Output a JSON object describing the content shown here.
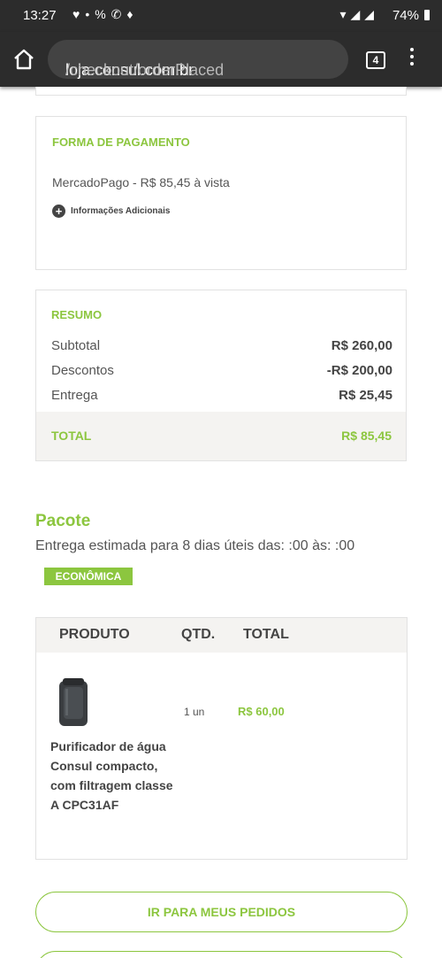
{
  "status_bar": {
    "time": "13:27",
    "battery": "74%"
  },
  "browser": {
    "url_domain": "loja.consul.com.br",
    "url_path": "/checkout/orderPlaced",
    "tab_count": "4"
  },
  "payment": {
    "title": "FORMA DE PAGAMENTO",
    "method": "MercadoPago - R$ 85,45 à vista",
    "info_link": "Informações Adicionais"
  },
  "summary": {
    "title": "RESUMO",
    "rows": [
      {
        "label": "Subtotal",
        "value": "R$ 260,00"
      },
      {
        "label": "Descontos",
        "value": "-R$ 200,00"
      },
      {
        "label": "Entrega",
        "value": "R$ 25,45"
      }
    ],
    "total_label": "TOTAL",
    "total_value": "R$ 85,45"
  },
  "package": {
    "title": "Pacote",
    "delivery": "Entrega estimada para 8 dias úteis das: :00 às: :00",
    "badge": "ECONÔMICA"
  },
  "products": {
    "headers": {
      "product": "PRODUTO",
      "qty": "QTD.",
      "total": "TOTAL"
    },
    "items": [
      {
        "name": "Purificador de água Consul compacto, com filtragem classe A CPC31AF",
        "qty": "1 un",
        "total": "R$ 60,00"
      }
    ]
  },
  "buttons": {
    "my_orders": "IR PARA MEUS PEDIDOS"
  },
  "colors": {
    "accent": "#8cc63f",
    "topbar": "#2c2c2c"
  }
}
